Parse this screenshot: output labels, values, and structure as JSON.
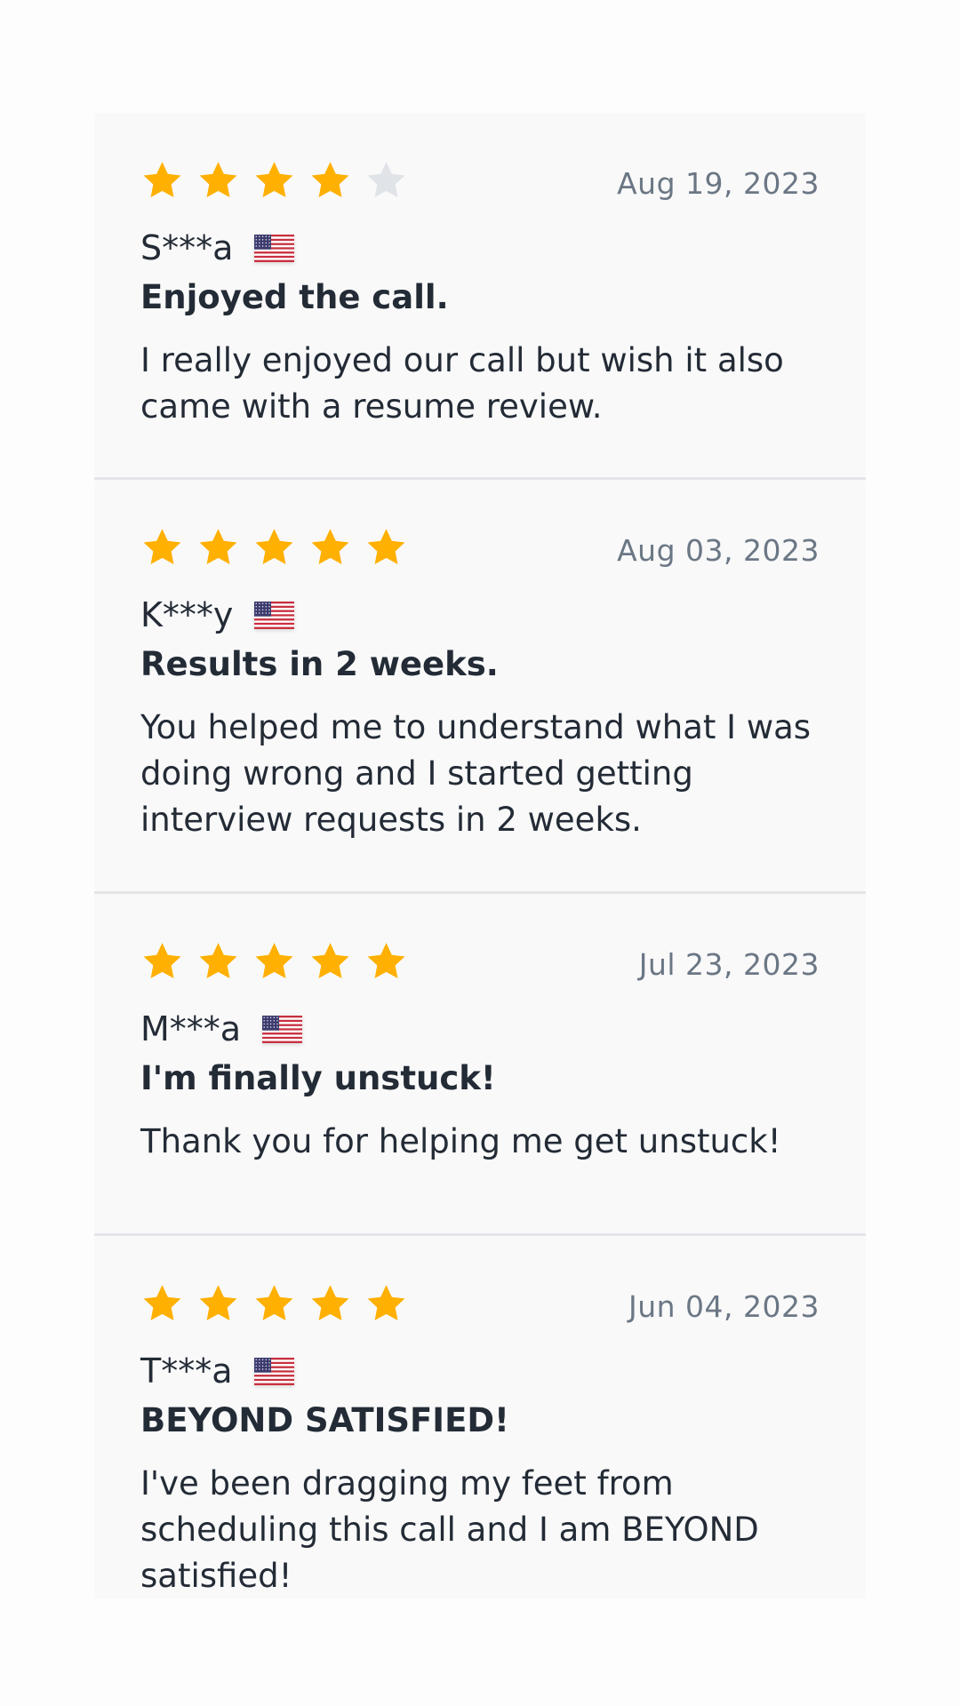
{
  "colors": {
    "star_filled": "#FFB000",
    "star_empty": "#E0E3E7",
    "date_text": "#6B7785",
    "body_text": "#232B36",
    "card_background": "#F9F9F9",
    "divider": "#E3E5E8"
  },
  "reviews": [
    {
      "rating": 4,
      "max_rating": 5,
      "date": "Aug 19, 2023",
      "reviewer": "S***a",
      "country_icon": "us-flag-icon",
      "title": "Enjoyed the call.",
      "body": "I really enjoyed our call but wish it also came with a resume review."
    },
    {
      "rating": 5,
      "max_rating": 5,
      "date": "Aug 03, 2023",
      "reviewer": "K***y",
      "country_icon": "us-flag-icon",
      "title": "Results in 2 weeks.",
      "body": "You helped me to understand what I was doing wrong and I started getting interview requests in 2 weeks."
    },
    {
      "rating": 5,
      "max_rating": 5,
      "date": "Jul 23, 2023",
      "reviewer": "M***a",
      "country_icon": "us-flag-icon",
      "title": "I'm finally unstuck!",
      "body": "Thank you for helping me get unstuck!"
    },
    {
      "rating": 5,
      "max_rating": 5,
      "date": "Jun 04, 2023",
      "reviewer": "T***a",
      "country_icon": "us-flag-icon",
      "title": "BEYOND SATISFIED!",
      "body": "I've been dragging my feet from scheduling this call and I am BEYOND satisfied!"
    }
  ]
}
